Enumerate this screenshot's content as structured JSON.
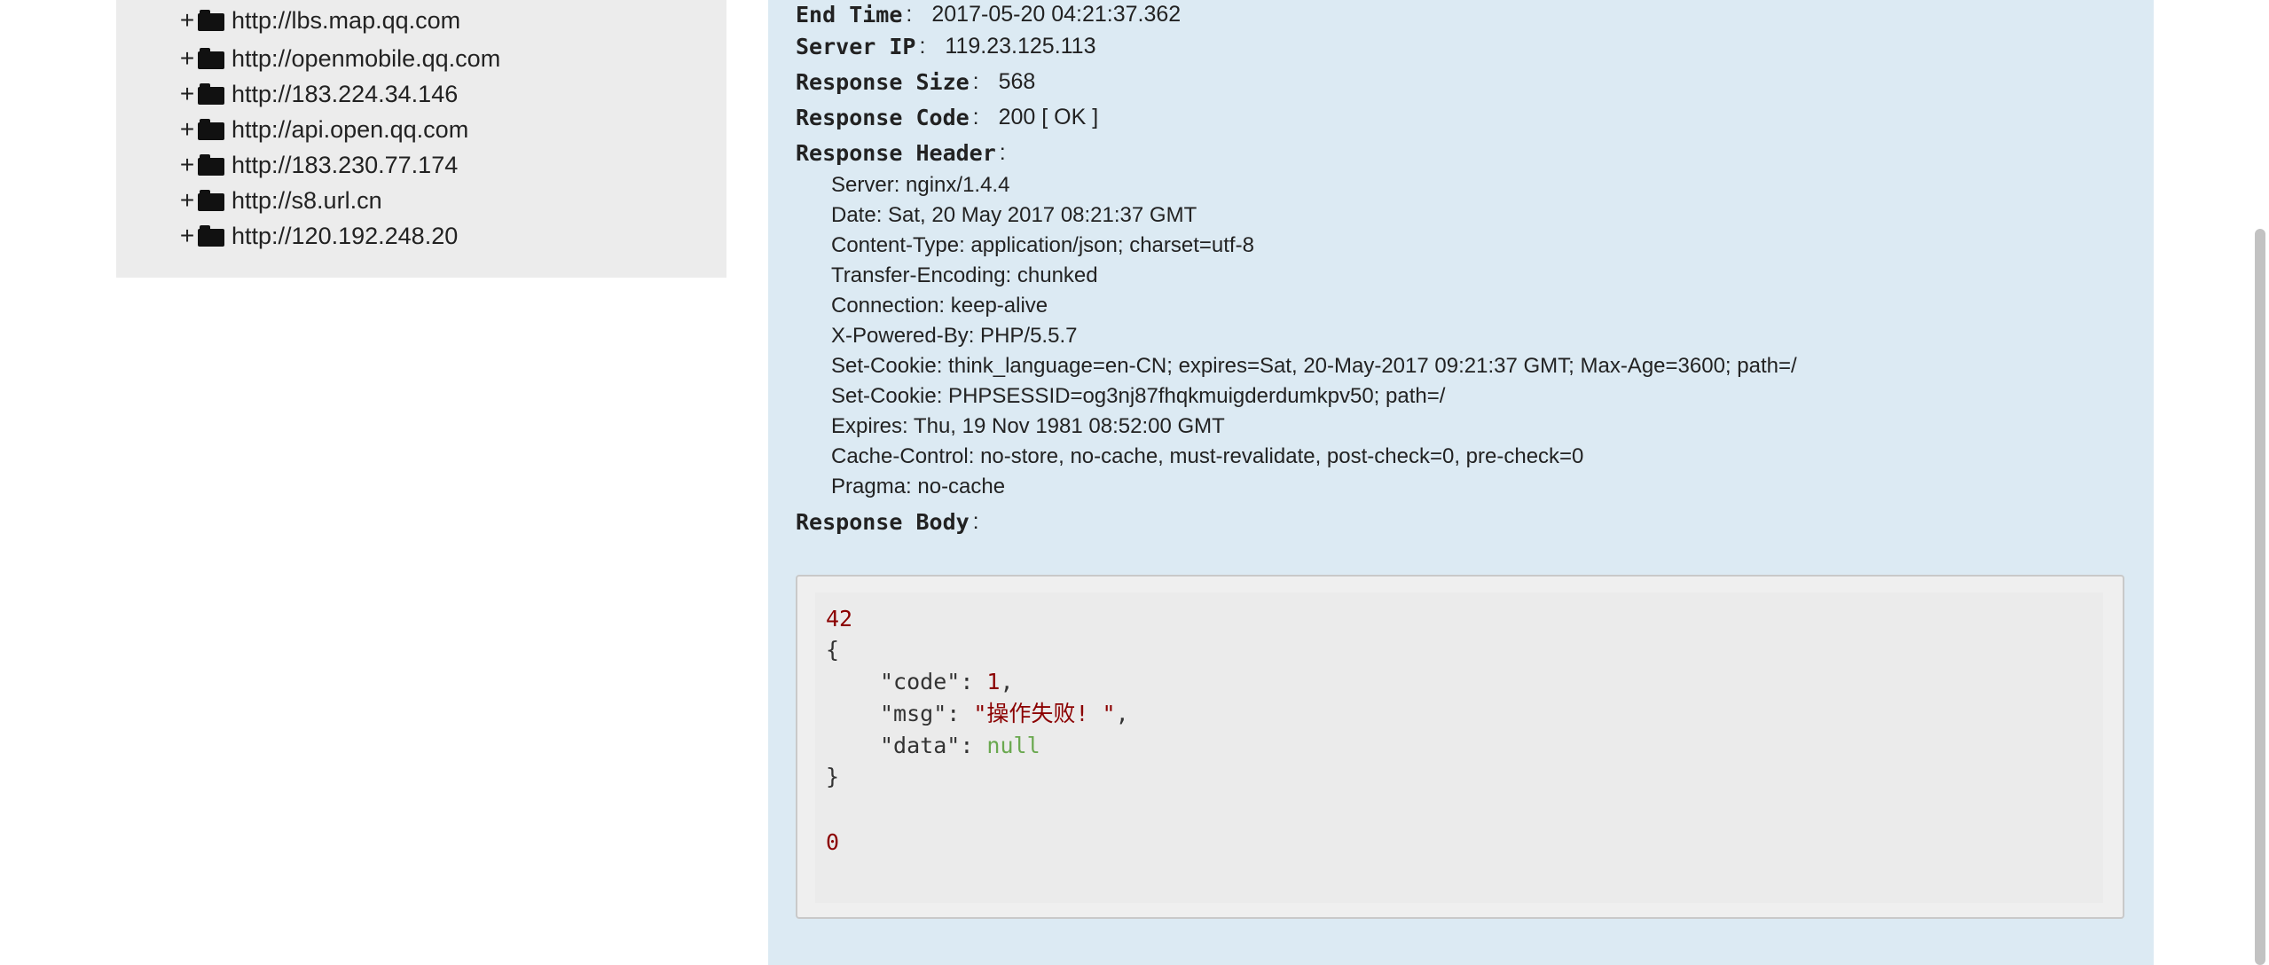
{
  "tree": {
    "expander_symbol": "+",
    "items": [
      {
        "label": "http://lbs.map.qq.com"
      },
      {
        "label": "http://openmobile.qq.com"
      },
      {
        "label": "http://183.224.34.146"
      },
      {
        "label": "http://api.open.qq.com"
      },
      {
        "label": "http://183.230.77.174"
      },
      {
        "label": "http://s8.url.cn"
      },
      {
        "label": "http://120.192.248.20"
      }
    ]
  },
  "details": {
    "colon": ":",
    "end_time": {
      "label": "End Time",
      "value": "2017-05-20 04:21:37.362"
    },
    "server_ip": {
      "label": "Server IP",
      "value": "119.23.125.113"
    },
    "response_size": {
      "label": "Response Size",
      "value": "568"
    },
    "response_code": {
      "label": "Response Code",
      "value": "200 [ OK ]"
    },
    "response_header": {
      "label": "Response Header",
      "lines": [
        "Server: nginx/1.4.4",
        "Date: Sat, 20 May 2017 08:21:37 GMT",
        "Content-Type: application/json; charset=utf-8",
        "Transfer-Encoding: chunked",
        "Connection: keep-alive",
        "X-Powered-By: PHP/5.5.7",
        "Set-Cookie: think_language=en-CN; expires=Sat, 20-May-2017 09:21:37 GMT; Max-Age=3600; path=/",
        "Set-Cookie: PHPSESSID=og3nj87fhqkmuigderdumkpv50; path=/",
        "Expires: Thu, 19 Nov 1981 08:52:00 GMT",
        "Cache-Control: no-store, no-cache, must-revalidate, post-check=0, pre-check=0",
        "Pragma: no-cache"
      ]
    },
    "response_body": {
      "label": "Response Body",
      "chunk_size": "42",
      "open_brace": "{",
      "close_brace": "}",
      "fields": [
        {
          "key": "\"code\"",
          "value": "1",
          "type": "number",
          "comma": ","
        },
        {
          "key": "\"msg\"",
          "value": "\"操作失败! \"",
          "type": "string",
          "comma": ","
        },
        {
          "key": "\"data\"",
          "value": "null",
          "type": "null",
          "comma": ""
        }
      ],
      "terminator": "0"
    }
  },
  "colors": {
    "panel_bg": "#dceaf3",
    "tree_bg": "#ececec",
    "number_color": "#8b0000",
    "null_color": "#6aa84f"
  }
}
